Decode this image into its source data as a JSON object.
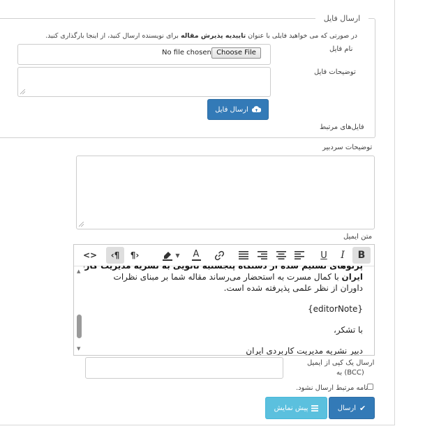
{
  "file_section": {
    "legend": "ارسال فایل",
    "note_prefix": "در صورتی که می خواهید فایلی با عنوان",
    "note_bold": "تاییدیه پذیرش مقاله",
    "note_suffix": "برای نویسنده ارسال کنید، از اینجا بارگذاری کنید.",
    "file_name_label": "نام فایل",
    "file_status": "No file chosen",
    "choose_file_label": "Choose File",
    "file_desc_label": "توضیحات فایل",
    "upload_button": "ارسال فایل",
    "related_files_label": "فایل‌های مرتبط"
  },
  "editor_notes": {
    "label": "توضیحات سردبیر",
    "value": ""
  },
  "email": {
    "label": "متن ایمیل",
    "body_line_cut": "پرتوهای تسلیم شده از دستگاه پنجشنبه نانویی به نشریه مدیریت کاربردی",
    "body_line_1_bold": "ایران",
    "body_line_1": "با کمال مسرت به استحضار می‌رساند مقاله شما بر مبنای نظرات",
    "body_line_2": "داوران از نظر علمی پذیرفته شده است.",
    "editor_note": "{editorNote}",
    "thanks": "با تشکر،",
    "signature_cut": "دبیر نشریه مدیریت کاربردی ایران"
  },
  "toolbar": {
    "icons": [
      "bold-icon",
      "italic-icon",
      "underline-icon",
      "align-left-icon",
      "align-center-icon",
      "align-right-icon",
      "align-justify-icon",
      "link-icon",
      "font-color-icon",
      "highlight-icon",
      "ltr-icon",
      "rtl-icon",
      "source-code-icon"
    ],
    "bold": "B",
    "italic": "I",
    "underline": "U",
    "font_color": "A",
    "ltr": "¶›",
    "rtl": "‹¶",
    "source": "<>"
  },
  "bcc": {
    "label_line1": "ارسال یک کپی از ایمیل",
    "label_line2": "(BCC) به",
    "value": ""
  },
  "no_send": {
    "label": "نامه مرتبط ارسال نشود.",
    "checked": false
  },
  "actions": {
    "send": "ارسال",
    "preview": "پیش نمایش"
  },
  "colors": {
    "primary": "#337ab7",
    "info": "#5bc0de"
  }
}
